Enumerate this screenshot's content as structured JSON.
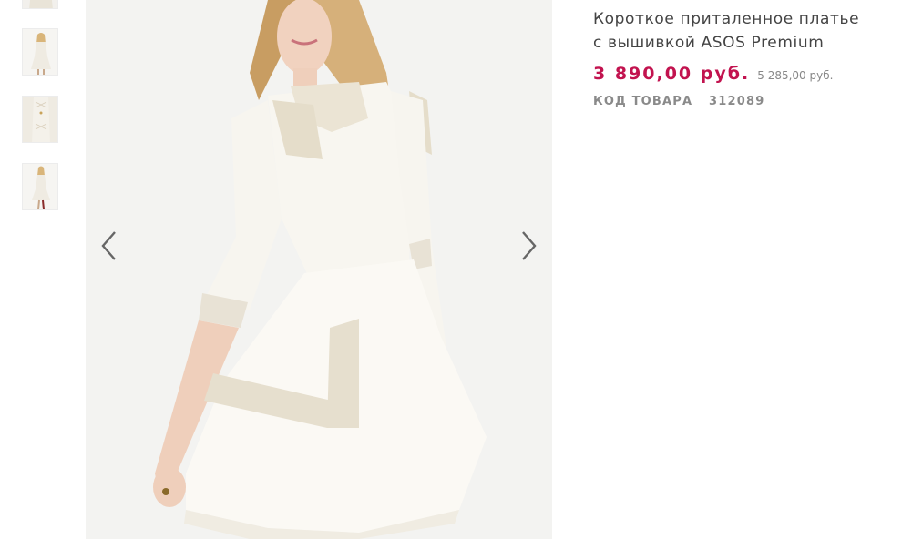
{
  "product": {
    "title": "Короткое приталенное платье с вышивкой ASOS Premium",
    "price": "3 890,00 руб.",
    "old_price": "5 285,00 руб.",
    "sku_label": "КОД ТОВАРА",
    "sku_value": "312089"
  },
  "gallery": {
    "prev_icon": "chevron-left-icon",
    "next_icon": "chevron-right-icon"
  },
  "colors": {
    "price": "#c2134f",
    "title": "#444444",
    "sku": "#8a8a8a"
  }
}
